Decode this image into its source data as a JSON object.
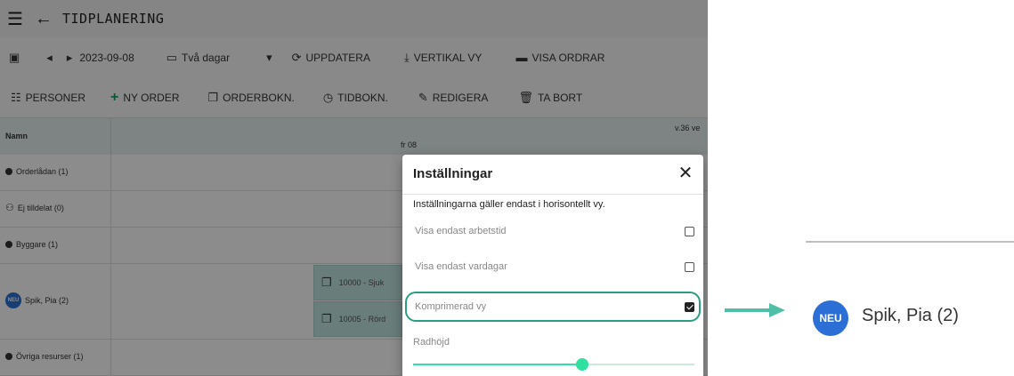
{
  "header": {
    "title": "TIDPLANERING"
  },
  "toolbar1": {
    "date": "2023-09-08",
    "period": "Två dagar",
    "update": "UPPDATERA",
    "vertical": "VERTIKAL VY",
    "show_orders": "VISA ORDRAR"
  },
  "toolbar2": {
    "persons": "PERSONER",
    "new_order": "NY ORDER",
    "order_booking": "ORDERBOKN.",
    "time_booking": "TIDBOKN.",
    "edit": "REDIGERA",
    "delete": "TA BORT"
  },
  "grid": {
    "name_header": "Namn",
    "day_label": "fr 08",
    "week_label": "v.36 ve"
  },
  "rows": [
    {
      "label": "Orderlådan (1)"
    },
    {
      "label": "Ej tilldelat (0)"
    },
    {
      "label": "Byggare (1)"
    },
    {
      "label": "Spik, Pia (2)",
      "avatar": "NEU"
    },
    {
      "label": "Övriga resurser (1)"
    }
  ],
  "orders": [
    {
      "label": "10000 - Sjuk"
    },
    {
      "label": "10005 - Rörd"
    }
  ],
  "dialog": {
    "title": "Inställningar",
    "note": "Inställningarna gäller endast i horisontellt vy.",
    "options": [
      {
        "label": "Visa endast arbetstid",
        "checked": false
      },
      {
        "label": "Visa endast vardagar",
        "checked": false
      },
      {
        "label": "Komprimerad vy",
        "checked": true
      }
    ],
    "slider_label": "Radhöjd",
    "slider_value": 0.6
  },
  "callout": {
    "avatar": "NEU",
    "name": "Spik, Pia (2)"
  },
  "colors": {
    "accent_green": "#2a9e82",
    "avatar_blue": "#2b6fd6",
    "slider": "#2fe0a0"
  }
}
